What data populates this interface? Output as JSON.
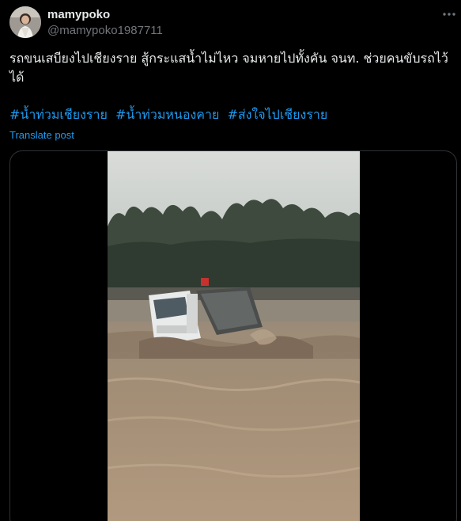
{
  "author": {
    "display_name": "mamypoko",
    "handle": "@mamypoko1987711",
    "avatar_icon": "profile-photo"
  },
  "post": {
    "text": "รถขนเสบียงไปเชียงราย สู้กระแสน้ำไม่ไหว จมหายไปทั้งคัน จนท. ช่วยคนขับรถไว้ได้",
    "hashtags": [
      "#น้ำท่วมเชียงราย",
      "#น้ำท่วมหนองคาย",
      "#ส่งใจไปเชียงราย"
    ],
    "translate_label": "Translate post"
  },
  "media": {
    "type": "video",
    "description_icon": "flood-truck-video"
  },
  "colors": {
    "background": "#000000",
    "text": "#e7e9ea",
    "secondary_text": "#71767b",
    "link": "#1d9bf0",
    "border": "#2f3336"
  },
  "icons": {
    "more": "more-options-icon"
  }
}
